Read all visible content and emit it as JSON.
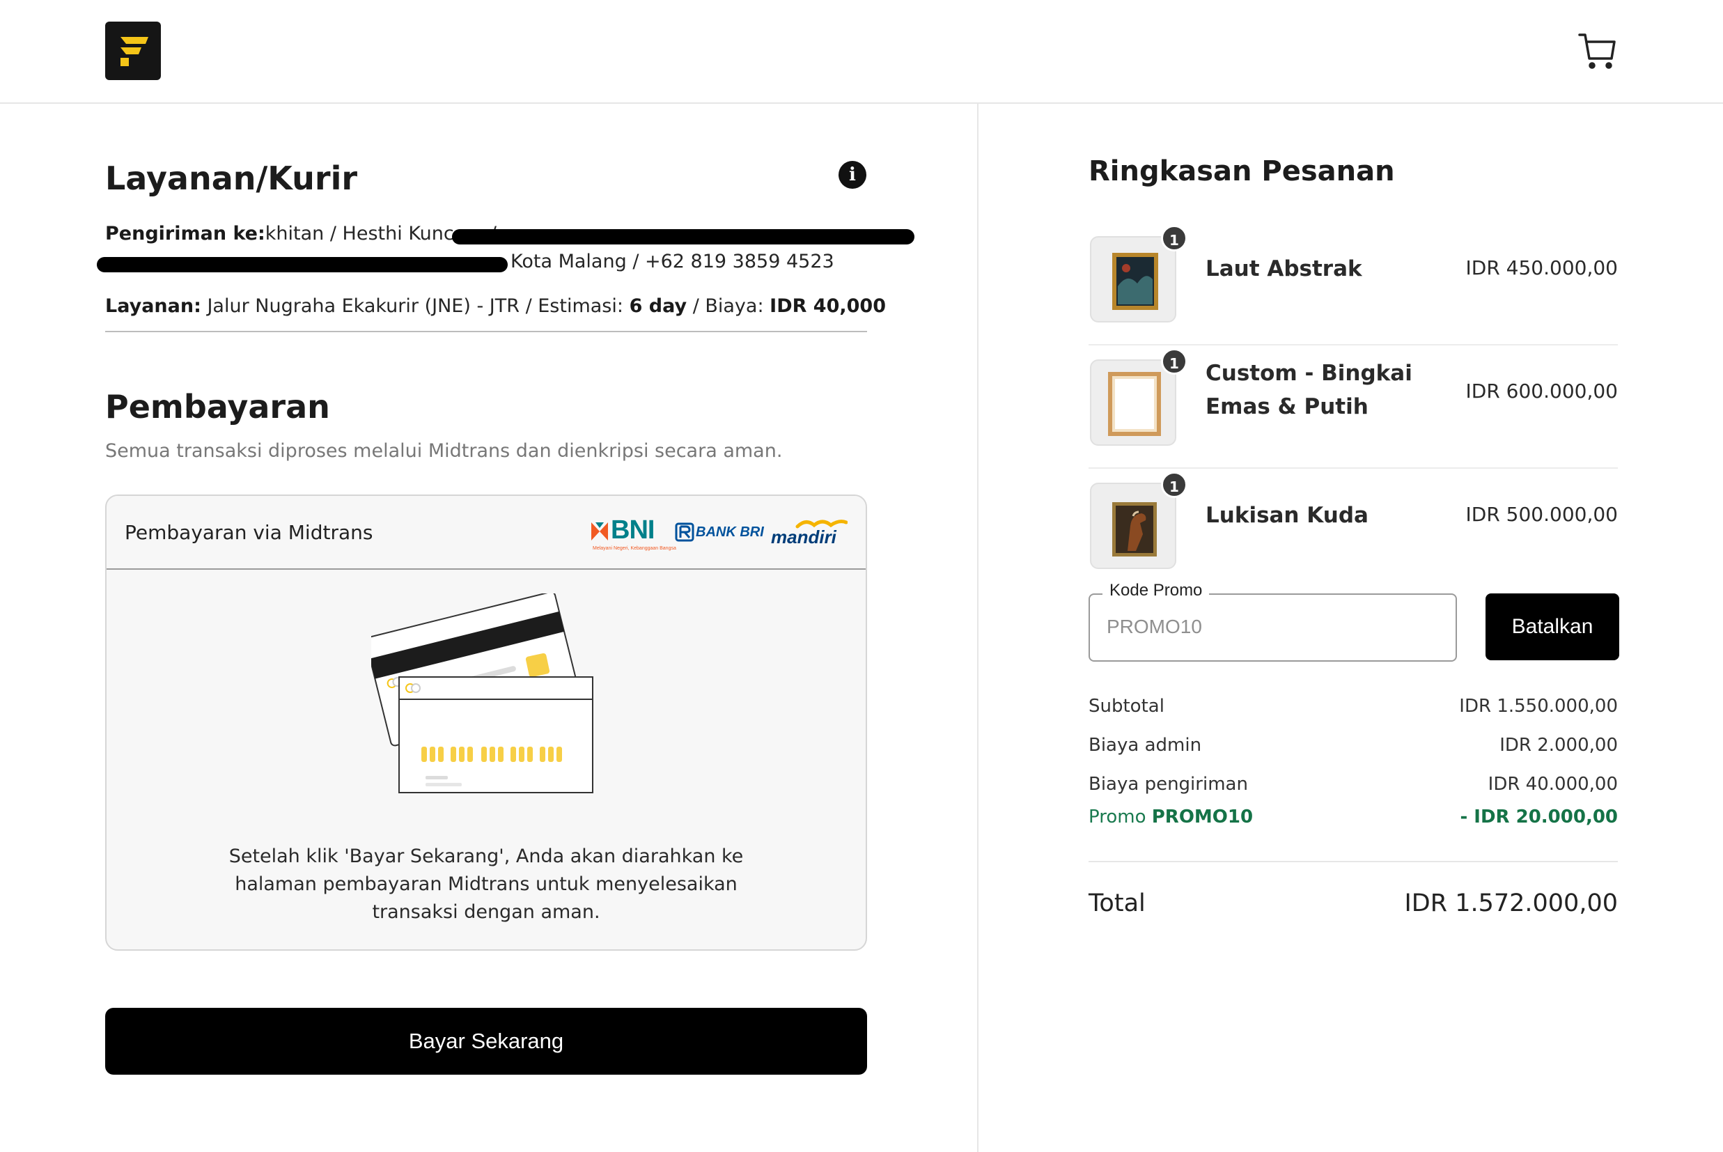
{
  "header": {
    "logo_icon": "brand-f-logo-icon",
    "cart_icon": "shopping-cart-icon"
  },
  "shipping": {
    "title": "Layanan/Kurir",
    "recipient_label": "Pengiriman ke:",
    "recipient_value_start": "khitan / Hesthi Kuncoro /",
    "recipient_value_end": "Kota Malang / +62 819 3859 4523",
    "service_label": "Layanan:",
    "service_text": "Jalur Nugraha Ekakurir (JNE) - JTR / Estimasi:",
    "estimate": "6 day",
    "cost_label": "/ Biaya:",
    "cost_value": "IDR 40,000"
  },
  "payment": {
    "title": "Pembayaran",
    "subtitle": "Semua transaksi diproses melalui Midtrans dan dienkripsi secara aman.",
    "method_label": "Pembayaran via Midtrans",
    "banks": [
      {
        "name": "BNI",
        "tagline": "Melayani Negeri, Kebanggaan Bangsa",
        "color": "#f15a23"
      },
      {
        "name": "BANK BRI",
        "color": "#00529c"
      },
      {
        "name": "mandiri",
        "color": "#003d79"
      }
    ],
    "note": "Setelah klik 'Bayar Sekarang', Anda akan diarahkan ke halaman pembayaran Midtrans untuk menyelesaikan transaksi dengan aman.",
    "pay_button": "Bayar Sekarang"
  },
  "summary": {
    "title": "Ringkasan Pesanan",
    "items": [
      {
        "name": "Laut Abstrak",
        "price": "IDR 450.000,00",
        "qty": "1"
      },
      {
        "name": "Custom - Bingkai Emas & Putih",
        "price": "IDR 600.000,00",
        "qty": "1"
      },
      {
        "name": "Lukisan Kuda",
        "price": "IDR 500.000,00",
        "qty": "1"
      }
    ],
    "promo": {
      "label": "Kode Promo",
      "placeholder": "PROMO10",
      "cancel_button": "Batalkan"
    },
    "subtotal_label": "Subtotal",
    "subtotal_value": "IDR 1.550.000,00",
    "admin_label": "Biaya admin",
    "admin_value": "IDR 2.000,00",
    "shipping_label": "Biaya pengiriman",
    "shipping_value": "IDR 40.000,00",
    "promo_label": "Promo",
    "promo_code": "PROMO10",
    "promo_value": "- IDR 20.000,00",
    "total_label": "Total",
    "total_value": "IDR 1.572.000,00"
  },
  "colors": {
    "accent": "#000000",
    "promo_green": "#157347",
    "logo_yellow": "#f5c518"
  }
}
